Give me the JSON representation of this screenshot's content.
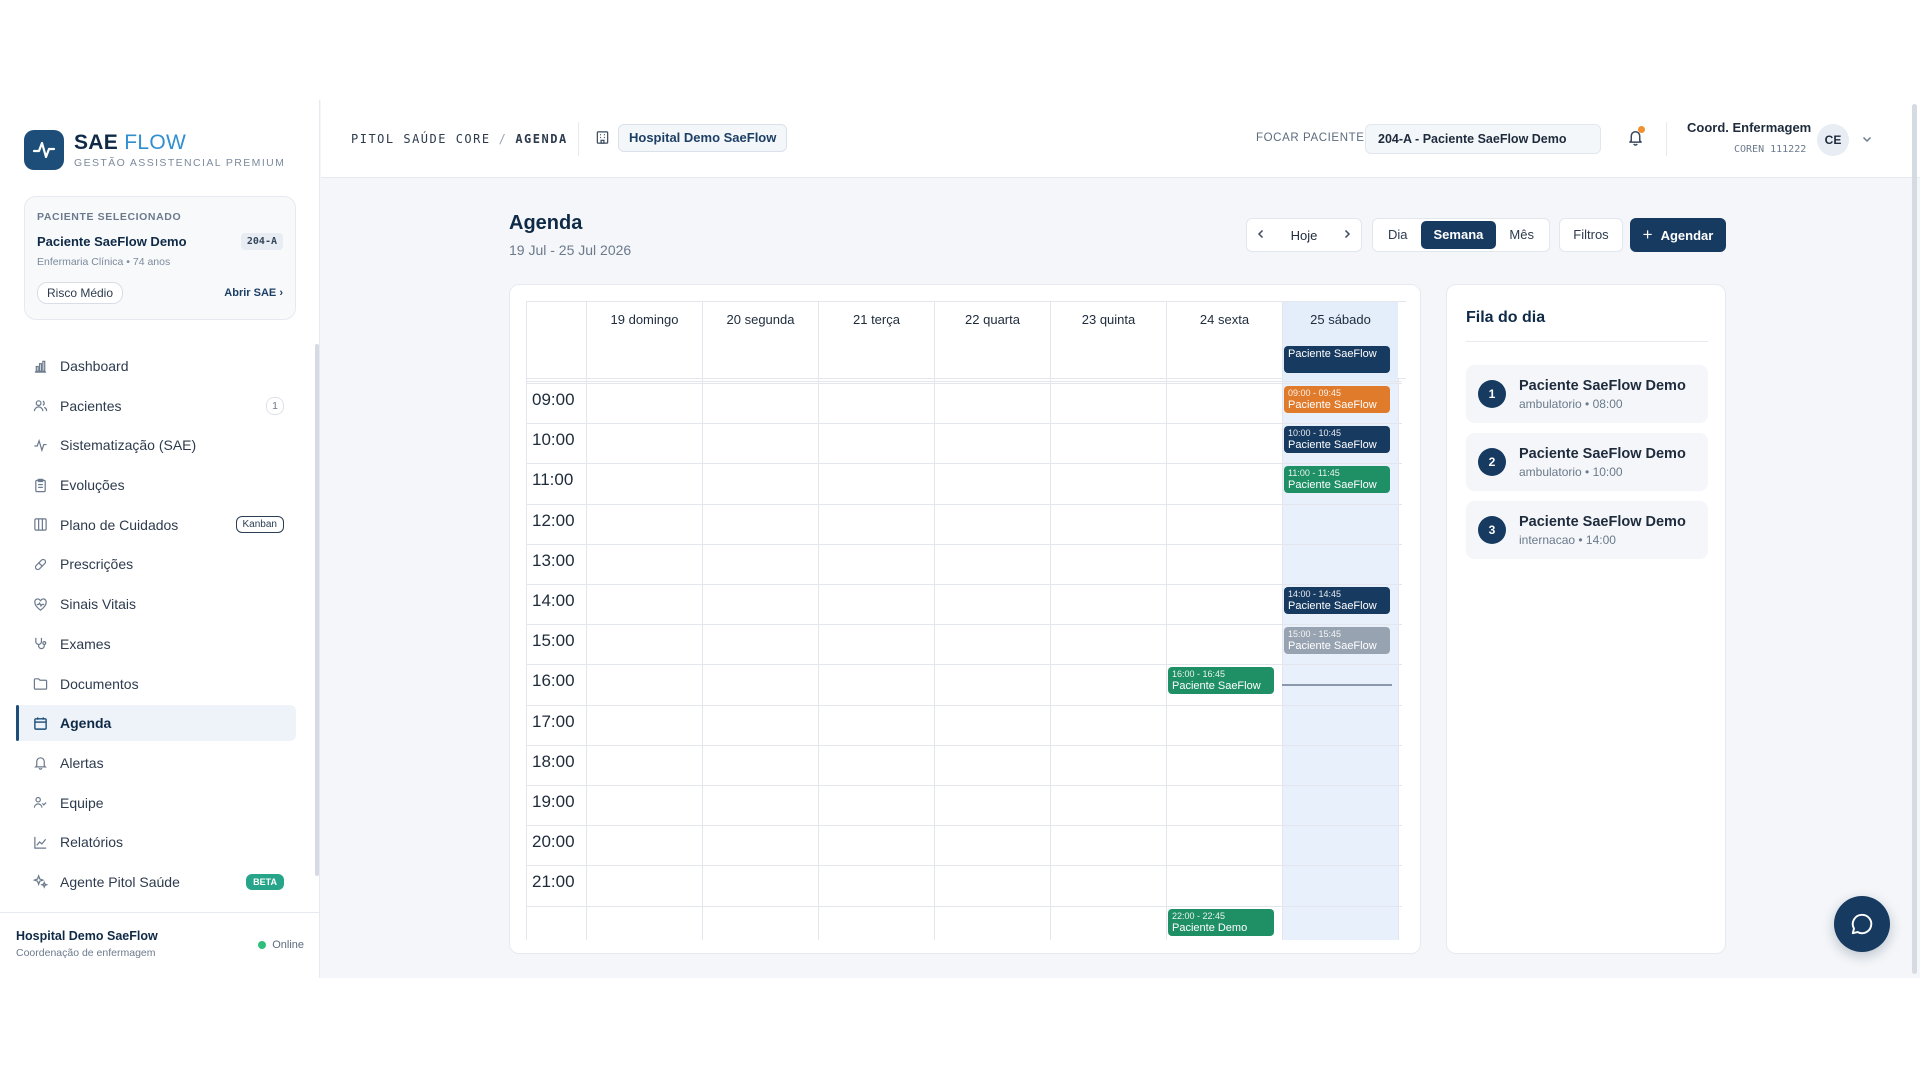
{
  "brand": {
    "name_primary": "SAE",
    "name_secondary": "FLOW",
    "tagline": "GESTÃO ASSISTENCIAL PREMIUM",
    "color": "#1d4e79"
  },
  "selected_patient": {
    "label": "PACIENTE SELECIONADO",
    "name": "Paciente SaeFlow Demo",
    "bed": "204-A",
    "info": "Enfermaria Clínica • 74 anos",
    "risk": "Risco Médio",
    "open_sae": "Abrir SAE"
  },
  "sidebar": {
    "items": [
      {
        "label": "Dashboard",
        "icon": "bar-chart-icon"
      },
      {
        "label": "Pacientes",
        "icon": "users-icon",
        "count": "1"
      },
      {
        "label": "Sistematização (SAE)",
        "icon": "activity-icon"
      },
      {
        "label": "Evoluções",
        "icon": "clipboard-icon"
      },
      {
        "label": "Plano de Cuidados",
        "icon": "board-icon",
        "tag": "Kanban"
      },
      {
        "label": "Prescrições",
        "icon": "pill-icon"
      },
      {
        "label": "Sinais Vitais",
        "icon": "heart-pulse-icon"
      },
      {
        "label": "Exames",
        "icon": "stethoscope-icon"
      },
      {
        "label": "Documentos",
        "icon": "folder-icon"
      },
      {
        "label": "Agenda",
        "icon": "calendar-icon",
        "active": true
      },
      {
        "label": "Alertas",
        "icon": "bell-icon"
      },
      {
        "label": "Equipe",
        "icon": "team-icon"
      },
      {
        "label": "Relatórios",
        "icon": "line-chart-icon"
      },
      {
        "label": "Agente Pitol Saúde",
        "icon": "sparkles-icon",
        "beta": "BETA"
      }
    ],
    "footer": {
      "hospital": "Hospital Demo SaeFlow",
      "role": "Coordenação de enfermagem",
      "status": "Online"
    }
  },
  "header": {
    "breadcrumb": [
      "PITOL SAÚDE CORE",
      "AGENDA"
    ],
    "breadcrumb_sep": "/",
    "hospital": "Hospital Demo SaeFlow",
    "focus_label": "FOCAR PACIENTE:",
    "focus_value": "204-A - Paciente SaeFlow Demo",
    "user_name": "Coord. Enfermagem",
    "user_coren": "COREN 111222",
    "user_initials": "CE"
  },
  "agenda": {
    "title": "Agenda",
    "range": "19 Jul - 25 Jul 2026",
    "today_btn": "Hoje",
    "views": [
      "Dia",
      "Semana",
      "Mês"
    ],
    "active_view": "Semana",
    "filters": "Filtros",
    "schedule": "Agendar"
  },
  "calendar": {
    "days": [
      "19 domingo",
      "20 segunda",
      "21 terça",
      "22 quarta",
      "23 quinta",
      "24 sexta",
      "25 sábado"
    ],
    "today_index": 6,
    "hours": [
      "09:00",
      "10:00",
      "11:00",
      "12:00",
      "13:00",
      "14:00",
      "15:00",
      "16:00",
      "17:00",
      "18:00",
      "19:00",
      "20:00",
      "21:00"
    ],
    "first_hour": 9,
    "now_hour": 16.5,
    "events": [
      {
        "day": 6,
        "start": 8.0,
        "end": 8.75,
        "time": "",
        "title": "Paciente SaeFlow",
        "color": "#173a61"
      },
      {
        "day": 6,
        "start": 9.0,
        "end": 9.75,
        "time": "09:00 - 09:45",
        "title": "Paciente SaeFlow",
        "color": "#e07b2c"
      },
      {
        "day": 6,
        "start": 10.0,
        "end": 10.75,
        "time": "10:00 - 10:45",
        "title": "Paciente SaeFlow",
        "color": "#173a61"
      },
      {
        "day": 6,
        "start": 11.0,
        "end": 11.75,
        "time": "11:00 - 11:45",
        "title": "Paciente SaeFlow",
        "color": "#1f8f66"
      },
      {
        "day": 6,
        "start": 14.0,
        "end": 14.75,
        "time": "14:00 - 14:45",
        "title": "Paciente SaeFlow",
        "color": "#173a61"
      },
      {
        "day": 6,
        "start": 15.0,
        "end": 15.75,
        "time": "15:00 - 15:45",
        "title": "Paciente SaeFlow",
        "color": "#98a3b1"
      },
      {
        "day": 5,
        "start": 16.0,
        "end": 16.75,
        "time": "16:00 - 16:45",
        "title": "Paciente SaeFlow",
        "color": "#1f8f66"
      },
      {
        "day": 5,
        "start": 22.0,
        "end": 22.75,
        "time": "22:00 - 22:45",
        "title": "Paciente Demo",
        "color": "#1f8f66"
      }
    ]
  },
  "queue": {
    "title": "Fila do dia",
    "items": [
      {
        "num": "1",
        "name": "Paciente SaeFlow Demo",
        "meta": "ambulatorio • 08:00"
      },
      {
        "num": "2",
        "name": "Paciente SaeFlow Demo",
        "meta": "ambulatorio • 10:00"
      },
      {
        "num": "3",
        "name": "Paciente SaeFlow Demo",
        "meta": "internacao • 14:00"
      }
    ]
  }
}
